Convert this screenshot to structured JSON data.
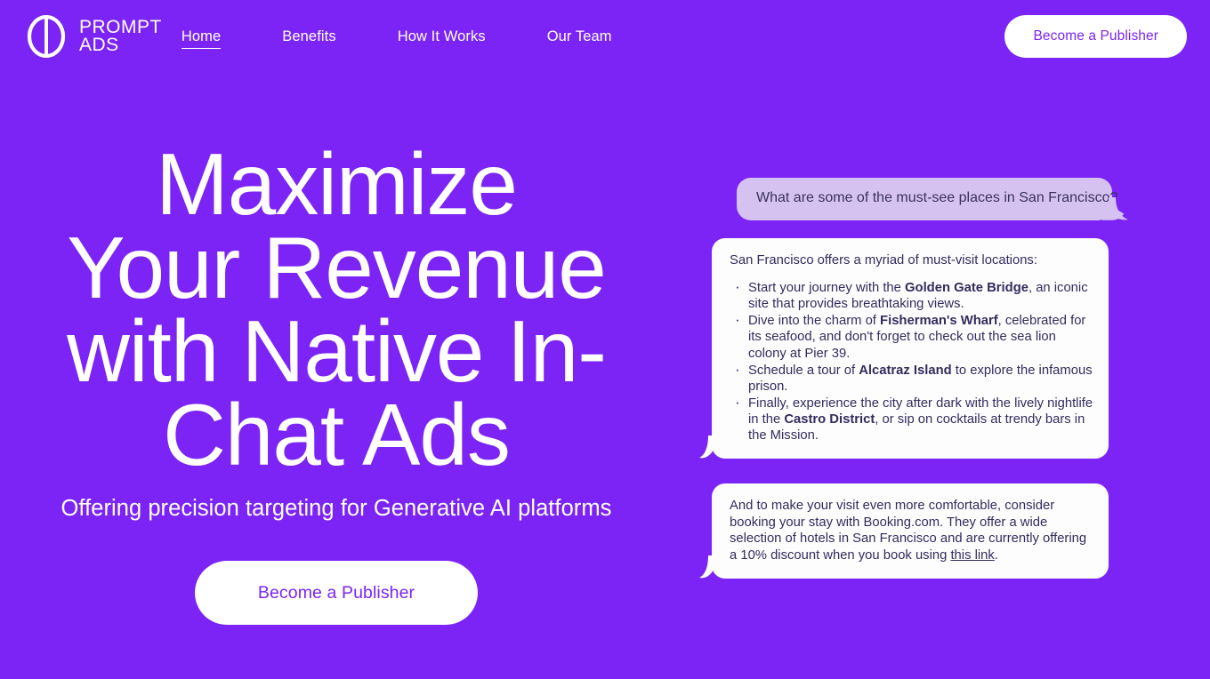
{
  "brand": {
    "line1": "PROMPT",
    "line2": "ADS",
    "logo_icon": "circle-split-logo-icon"
  },
  "nav": {
    "items": [
      {
        "label": "Home",
        "active": true
      },
      {
        "label": "Benefits",
        "active": false
      },
      {
        "label": "How It Works",
        "active": false
      },
      {
        "label": "Our Team",
        "active": false
      }
    ],
    "cta_label": "Become a Publisher"
  },
  "hero": {
    "title": "Maximize Your Revenue with Native In-Chat Ads",
    "subtitle": "Offering precision targeting for Generative AI platforms",
    "cta_label": "Become a Publisher"
  },
  "chat": {
    "user_message": "What are some of the must-see places in San Francisco?",
    "assistant": {
      "lead": "San Francisco offers a myriad of must-visit locations:",
      "bullets": [
        {
          "pre": "Start your journey with the ",
          "bold": "Golden Gate Bridge",
          "post": ", an iconic site that provides breathtaking views."
        },
        {
          "pre": "Dive into the charm of ",
          "bold": "Fisherman's Wharf",
          "post": ", celebrated for its seafood, and don't forget to check out the sea lion colony at Pier 39."
        },
        {
          "pre": "Schedule a tour of ",
          "bold": "Alcatraz Island",
          "post": " to explore the infamous prison."
        },
        {
          "pre": "Finally, experience the city after dark with the lively nightlife in the ",
          "bold": "Castro District",
          "post": ", or sip on cocktails at trendy bars in the Mission."
        }
      ]
    },
    "ad": {
      "pre": "And to make your visit even more comfortable, consider booking your stay with Booking.com. They offer a wide selection of hotels in San Francisco and are currently offering a 10% discount when you book using ",
      "link_label": "this link",
      "post": "."
    }
  },
  "colors": {
    "background": "#7B24F5",
    "surface_white": "#FFFFFF",
    "user_bubble": "#D6C2F0",
    "bubble_text": "#332C5E",
    "accent_text_on_white": "#7B24F5"
  }
}
